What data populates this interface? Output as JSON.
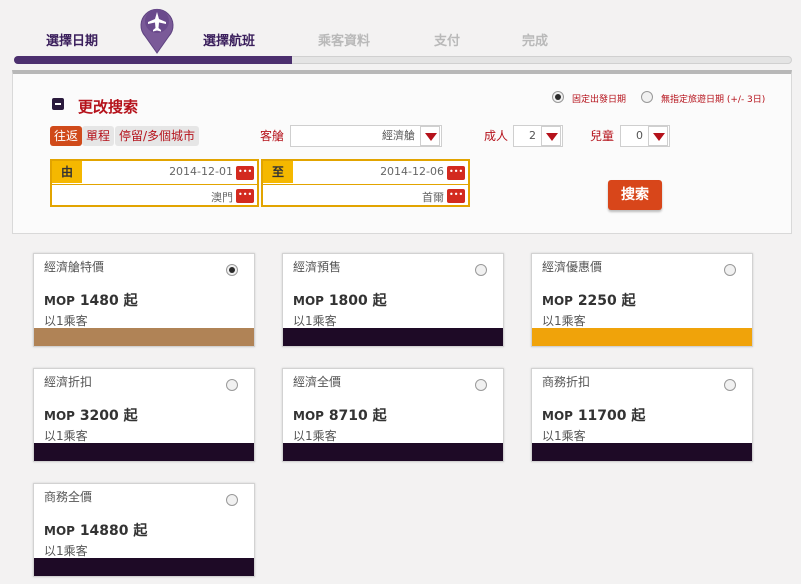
{
  "steps": [
    {
      "label": "選擇日期",
      "state": "done"
    },
    {
      "label": "選擇航班",
      "state": "active"
    },
    {
      "label": "乘客資料",
      "state": "pending"
    },
    {
      "label": "支付",
      "state": "pending"
    },
    {
      "label": "完成",
      "state": "pending"
    }
  ],
  "search": {
    "title": "更改搜索",
    "date_mode_fixed": "固定出發日期",
    "date_mode_flexible": "無指定旅遊日期 (+/- 3日)",
    "trip_types": [
      "往返",
      "單程",
      "停留/多個城市"
    ],
    "cabin_label": "客艙",
    "cabin_value": "經濟艙",
    "adult_label": "成人",
    "adult_value": "2",
    "child_label": "兒童",
    "child_value": "0",
    "from_label": "由",
    "from_date": "2014-12-01",
    "from_city": "澳門",
    "to_label": "至",
    "to_date": "2014-12-06",
    "to_city": "首爾",
    "button": "搜索"
  },
  "fares": [
    {
      "name": "經濟艙特價",
      "currency": "MOP",
      "amount": "1480",
      "suffix": "起",
      "pax": "以1乘客",
      "selected": true,
      "bar_color": "#b08356"
    },
    {
      "name": "經濟預售",
      "currency": "MOP",
      "amount": "1800",
      "suffix": "起",
      "pax": "以1乘客",
      "selected": false,
      "bar_color": "#1e0a26"
    },
    {
      "name": "經濟優惠價",
      "currency": "MOP",
      "amount": "2250",
      "suffix": "起",
      "pax": "以1乘客",
      "selected": false,
      "bar_color": "#f0a30a"
    },
    {
      "name": "經濟折扣",
      "currency": "MOP",
      "amount": "3200",
      "suffix": "起",
      "pax": "以1乘客",
      "selected": false,
      "bar_color": "#1e0a26"
    },
    {
      "name": "經濟全價",
      "currency": "MOP",
      "amount": "8710",
      "suffix": "起",
      "pax": "以1乘客",
      "selected": false,
      "bar_color": "#1e0a26"
    },
    {
      "name": "商務折扣",
      "currency": "MOP",
      "amount": "11700",
      "suffix": "起",
      "pax": "以1乘客",
      "selected": false,
      "bar_color": "#1e0a26"
    },
    {
      "name": "商務全價",
      "currency": "MOP",
      "amount": "14880",
      "suffix": "起",
      "pax": "以1乘客",
      "selected": false,
      "bar_color": "#1e0a26"
    }
  ]
}
